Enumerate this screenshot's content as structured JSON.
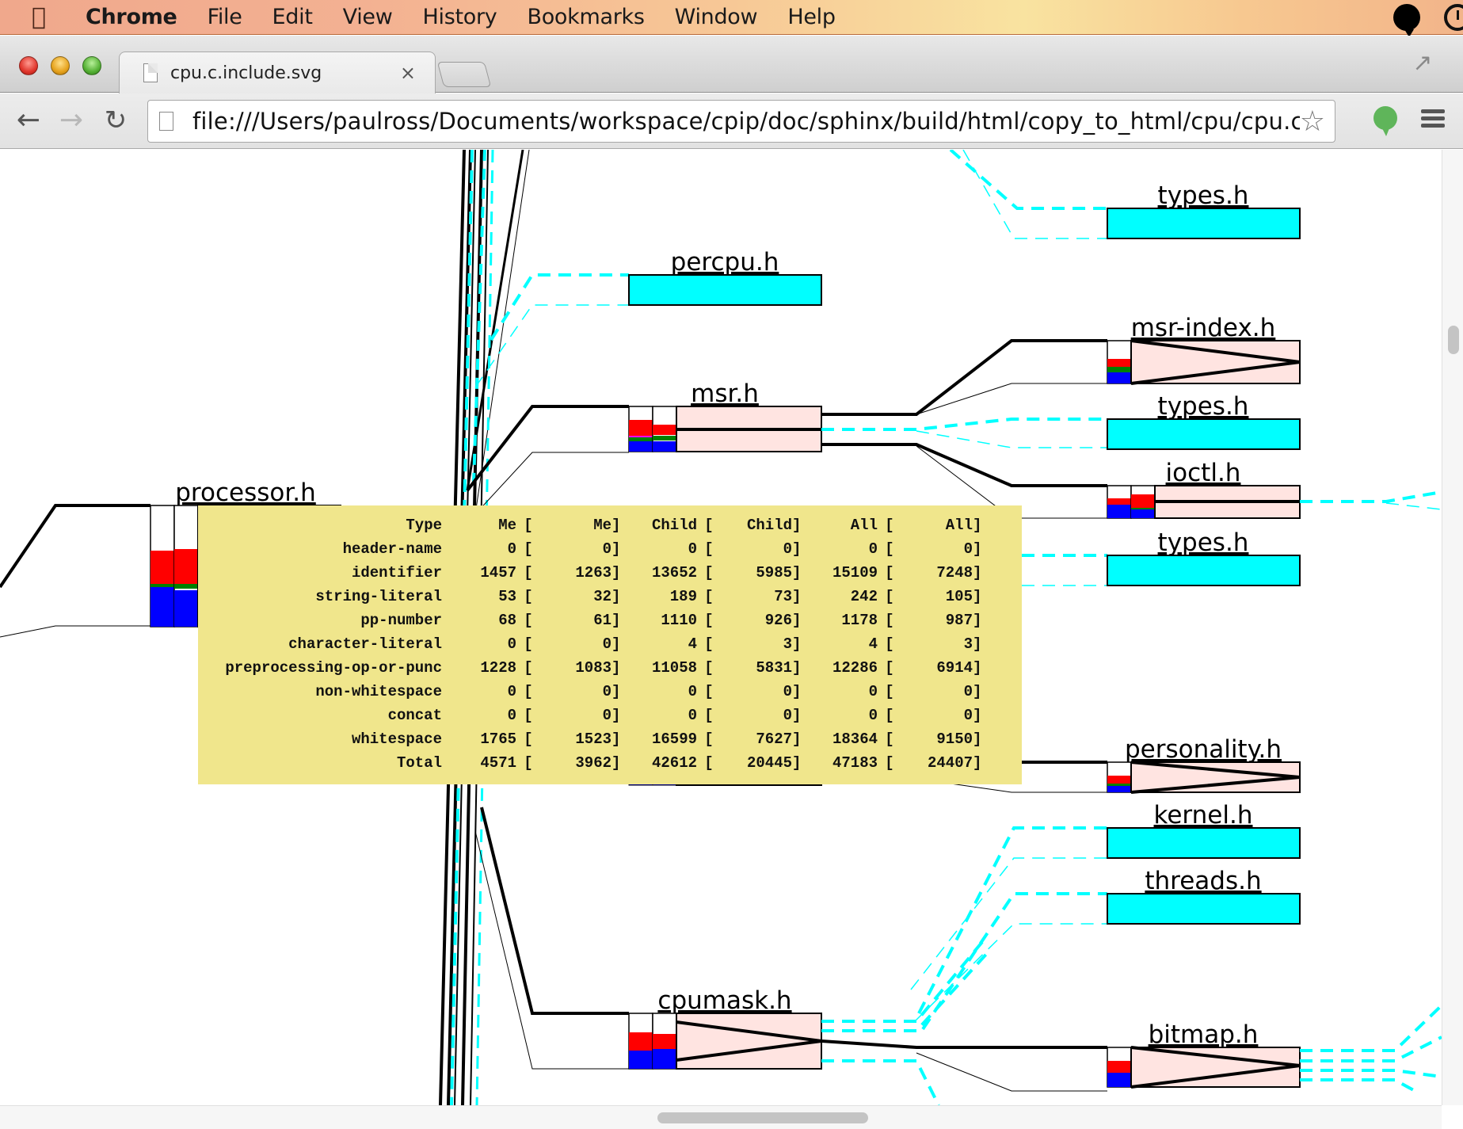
{
  "menubar": {
    "apple_icon": "apple-logo-icon",
    "items": [
      "Chrome",
      "File",
      "Edit",
      "View",
      "History",
      "Bookmarks",
      "Window",
      "Help"
    ],
    "status_icons": [
      "notification-bubble-icon",
      "time-machine-icon"
    ]
  },
  "browser": {
    "tab": {
      "title": "cpu.c.include.svg",
      "close": "×"
    },
    "url": "file:///Users/paulross/Documents/workspace/cpip/doc/sphinx/build/html/copy_to_html/cpu/cpu.c....",
    "nav": {
      "back": "←",
      "forward": "→",
      "reload": "↻",
      "star": "☆"
    }
  },
  "diagram": {
    "colors": {
      "leaf_fill": "#00ffff",
      "node_fill": "#ffe4e1",
      "identifier": "#ff0000",
      "pp_number": "#008000",
      "whitespace": "#0000ff",
      "string_literal": "#ff00ff",
      "conditional_edge": "#00ffff",
      "tooltip_bg": "#f0e68c"
    },
    "nodes": [
      {
        "label": "types.h",
        "kind": "leaf"
      },
      {
        "label": "percpu.h",
        "kind": "leaf"
      },
      {
        "label": "msr-index.h",
        "kind": "node"
      },
      {
        "label": "msr.h",
        "kind": "node"
      },
      {
        "label": "types.h",
        "kind": "leaf"
      },
      {
        "label": "ioctl.h",
        "kind": "node"
      },
      {
        "label": "processor.h",
        "kind": "node"
      },
      {
        "label": "types.h",
        "kind": "leaf"
      },
      {
        "label": "personality.h",
        "kind": "node"
      },
      {
        "label": "kernel.h",
        "kind": "leaf"
      },
      {
        "label": "threads.h",
        "kind": "leaf"
      },
      {
        "label": "cpumask.h",
        "kind": "node"
      },
      {
        "label": "bitmap.h",
        "kind": "node"
      }
    ]
  },
  "tooltip": {
    "headers": [
      "Type",
      "Me",
      "Me",
      "Child",
      "Child",
      "All",
      "All"
    ],
    "rows": [
      {
        "type": "header-name",
        "me": "0",
        "me_sig": "0",
        "child": "0",
        "child_sig": "0",
        "all": "0",
        "all_sig": "0"
      },
      {
        "type": "identifier",
        "me": "1457",
        "me_sig": "1263",
        "child": "13652",
        "child_sig": "5985",
        "all": "15109",
        "all_sig": "7248"
      },
      {
        "type": "string-literal",
        "me": "53",
        "me_sig": "32",
        "child": "189",
        "child_sig": "73",
        "all": "242",
        "all_sig": "105"
      },
      {
        "type": "pp-number",
        "me": "68",
        "me_sig": "61",
        "child": "1110",
        "child_sig": "926",
        "all": "1178",
        "all_sig": "987"
      },
      {
        "type": "character-literal",
        "me": "0",
        "me_sig": "0",
        "child": "4",
        "child_sig": "3",
        "all": "4",
        "all_sig": "3"
      },
      {
        "type": "preprocessing-op-or-punc",
        "me": "1228",
        "me_sig": "1083",
        "child": "11058",
        "child_sig": "5831",
        "all": "12286",
        "all_sig": "6914"
      },
      {
        "type": "non-whitespace",
        "me": "0",
        "me_sig": "0",
        "child": "0",
        "child_sig": "0",
        "all": "0",
        "all_sig": "0"
      },
      {
        "type": "concat",
        "me": "0",
        "me_sig": "0",
        "child": "0",
        "child_sig": "0",
        "all": "0",
        "all_sig": "0"
      },
      {
        "type": "whitespace",
        "me": "1765",
        "me_sig": "1523",
        "child": "16599",
        "child_sig": "7627",
        "all": "18364",
        "all_sig": "9150"
      },
      {
        "type": "Total",
        "me": "4571",
        "me_sig": "3962",
        "child": "42612",
        "child_sig": "20445",
        "all": "47183",
        "all_sig": "24407"
      }
    ]
  }
}
